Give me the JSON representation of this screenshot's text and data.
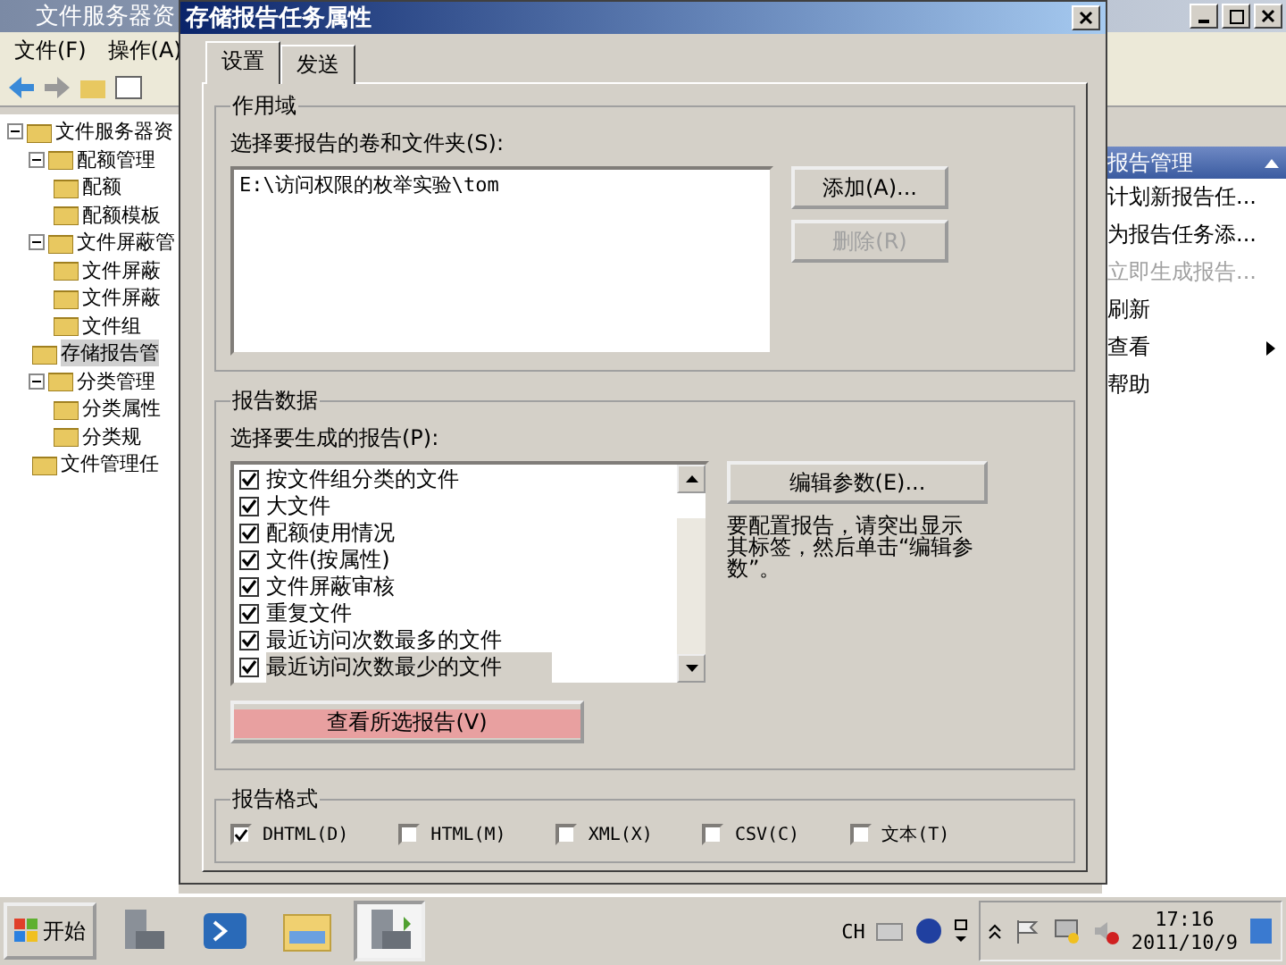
{
  "main_window": {
    "title": "文件服务器资",
    "menu": [
      "文件(F)",
      "操作(A)"
    ],
    "tree": [
      {
        "label": "文件服务器资",
        "selected": false,
        "expanded": true,
        "children": [
          {
            "label": "配额管理",
            "selected": false,
            "expanded": true,
            "children": [
              {
                "label": "配额",
                "selected": false
              },
              {
                "label": "配额模板",
                "selected": false
              }
            ]
          },
          {
            "label": "文件屏蔽管",
            "selected": false,
            "expanded": true,
            "children": [
              {
                "label": "文件屏蔽",
                "selected": false
              },
              {
                "label": "文件屏蔽",
                "selected": false
              },
              {
                "label": "文件组",
                "selected": false
              }
            ]
          },
          {
            "label": "存储报告管",
            "selected": true
          },
          {
            "label": "分类管理",
            "selected": false,
            "expanded": true,
            "children": [
              {
                "label": "分类属性",
                "selected": false
              },
              {
                "label": "分类规",
                "selected": false
              }
            ]
          },
          {
            "label": "文件管理任",
            "selected": false
          }
        ]
      }
    ],
    "actions": {
      "header": "报告管理",
      "items": [
        {
          "label": "计划新报告任...",
          "disabled": false,
          "submenu": false
        },
        {
          "label": "为报告任务添...",
          "disabled": false,
          "submenu": false
        },
        {
          "label": "立即生成报告...",
          "disabled": true,
          "submenu": false
        },
        {
          "label": "刷新",
          "disabled": false,
          "submenu": false
        },
        {
          "label": "查看",
          "disabled": false,
          "submenu": true
        },
        {
          "label": "帮助",
          "disabled": false,
          "submenu": false
        }
      ]
    }
  },
  "dialog": {
    "title": "存储报告任务属性",
    "tabs": [
      {
        "label": "设置",
        "selected": true
      },
      {
        "label": "发送",
        "selected": false
      }
    ],
    "scope": {
      "title": "作用域",
      "label": "选择要报告的卷和文件夹(S):",
      "folders": [
        "E:\\访问权限的枚举实验\\tom"
      ],
      "buttons": [
        {
          "label": "添加(A)...",
          "disabled": false
        },
        {
          "label": "删除(R)",
          "disabled": true
        }
      ]
    },
    "report_data": {
      "title": "报告数据",
      "label": "选择要生成的报告(P):",
      "reports": [
        {
          "label": "按文件组分类的文件",
          "checked": true,
          "selected": false
        },
        {
          "label": "大文件",
          "checked": true,
          "selected": false
        },
        {
          "label": "配额使用情况",
          "checked": true,
          "selected": false
        },
        {
          "label": "文件(按属性)",
          "checked": true,
          "selected": false
        },
        {
          "label": "文件屏蔽审核",
          "checked": true,
          "selected": false
        },
        {
          "label": "重复文件",
          "checked": true,
          "selected": false
        },
        {
          "label": "最近访问次数最多的文件",
          "checked": true,
          "selected": false
        },
        {
          "label": "最近访问次数最少的文件",
          "checked": true,
          "selected": true
        }
      ],
      "edit_button": "编辑参数(E)...",
      "hint": "要配置报告，请突出显示其标签，然后单击“编辑参数”。",
      "view_button": "查看所选报告(V)"
    },
    "formats": {
      "title": "报告格式",
      "options": [
        {
          "label": "DHTML(D)",
          "checked": true
        },
        {
          "label": "HTML(M)",
          "checked": false
        },
        {
          "label": "XML(X)",
          "checked": false
        },
        {
          "label": "CSV(C)",
          "checked": false
        },
        {
          "label": "文本(T)",
          "checked": false
        }
      ]
    }
  },
  "taskbar": {
    "start": "开始",
    "language": "CH",
    "time": "17:16",
    "date": "2011/10/9"
  }
}
